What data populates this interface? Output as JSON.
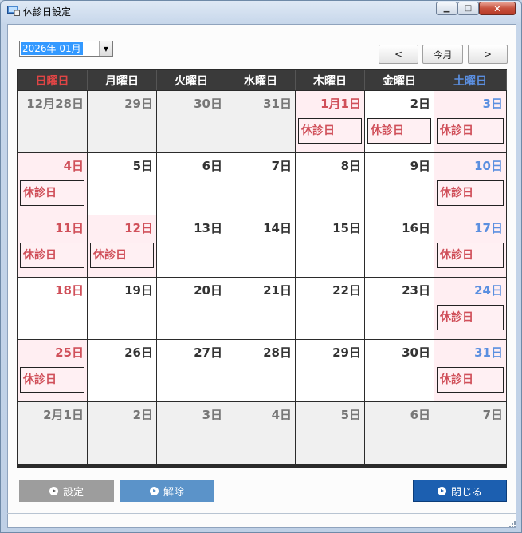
{
  "window": {
    "title": "休診日設定",
    "controls": {
      "minimize": "▁",
      "maximize": "□",
      "close": "✕"
    }
  },
  "toolbar": {
    "month_value": "2026年 01月",
    "prev_label": "<",
    "today_label": "今月",
    "next_label": ">"
  },
  "weekdays": [
    "日曜日",
    "月曜日",
    "火曜日",
    "水曜日",
    "木曜日",
    "金曜日",
    "土曜日"
  ],
  "holiday_label": "休診日",
  "weeks": [
    [
      {
        "label": "12月28日",
        "type": "other"
      },
      {
        "label": "29日",
        "type": "other"
      },
      {
        "label": "30日",
        "type": "other"
      },
      {
        "label": "31日",
        "type": "other"
      },
      {
        "label": "1月1日",
        "type": "holiday",
        "closed": true
      },
      {
        "label": "2日",
        "type": "normal",
        "closed": true
      },
      {
        "label": "3日",
        "type": "sat",
        "closed": true
      }
    ],
    [
      {
        "label": "4日",
        "type": "sun",
        "closed": true
      },
      {
        "label": "5日",
        "type": "normal"
      },
      {
        "label": "6日",
        "type": "normal"
      },
      {
        "label": "7日",
        "type": "normal"
      },
      {
        "label": "8日",
        "type": "normal"
      },
      {
        "label": "9日",
        "type": "normal"
      },
      {
        "label": "10日",
        "type": "sat",
        "closed": true
      }
    ],
    [
      {
        "label": "11日",
        "type": "sun",
        "closed": true
      },
      {
        "label": "12日",
        "type": "holiday",
        "closed": true
      },
      {
        "label": "13日",
        "type": "normal"
      },
      {
        "label": "14日",
        "type": "normal"
      },
      {
        "label": "15日",
        "type": "normal"
      },
      {
        "label": "16日",
        "type": "normal"
      },
      {
        "label": "17日",
        "type": "sat",
        "closed": true
      }
    ],
    [
      {
        "label": "18日",
        "type": "sun"
      },
      {
        "label": "19日",
        "type": "normal"
      },
      {
        "label": "20日",
        "type": "normal"
      },
      {
        "label": "21日",
        "type": "normal"
      },
      {
        "label": "22日",
        "type": "normal"
      },
      {
        "label": "23日",
        "type": "normal"
      },
      {
        "label": "24日",
        "type": "sat",
        "closed": true
      }
    ],
    [
      {
        "label": "25日",
        "type": "sun",
        "closed": true
      },
      {
        "label": "26日",
        "type": "normal"
      },
      {
        "label": "27日",
        "type": "normal"
      },
      {
        "label": "28日",
        "type": "normal"
      },
      {
        "label": "29日",
        "type": "normal"
      },
      {
        "label": "30日",
        "type": "normal"
      },
      {
        "label": "31日",
        "type": "sat",
        "closed": true
      }
    ],
    [
      {
        "label": "2月1日",
        "type": "other"
      },
      {
        "label": "2日",
        "type": "other"
      },
      {
        "label": "3日",
        "type": "other"
      },
      {
        "label": "4日",
        "type": "other"
      },
      {
        "label": "5日",
        "type": "other"
      },
      {
        "label": "6日",
        "type": "other"
      },
      {
        "label": "7日",
        "type": "other"
      }
    ]
  ],
  "buttons": {
    "set_label": "設定",
    "clear_label": "解除",
    "close_label": "閉じる"
  },
  "colors": {
    "sunday": "#d0505a",
    "saturday": "#5b8fe0",
    "holiday_bg": "#ffeef2",
    "close_button": "#1c5fb0",
    "clear_button": "#5b93c9",
    "set_button_disabled": "#9d9d9d"
  }
}
